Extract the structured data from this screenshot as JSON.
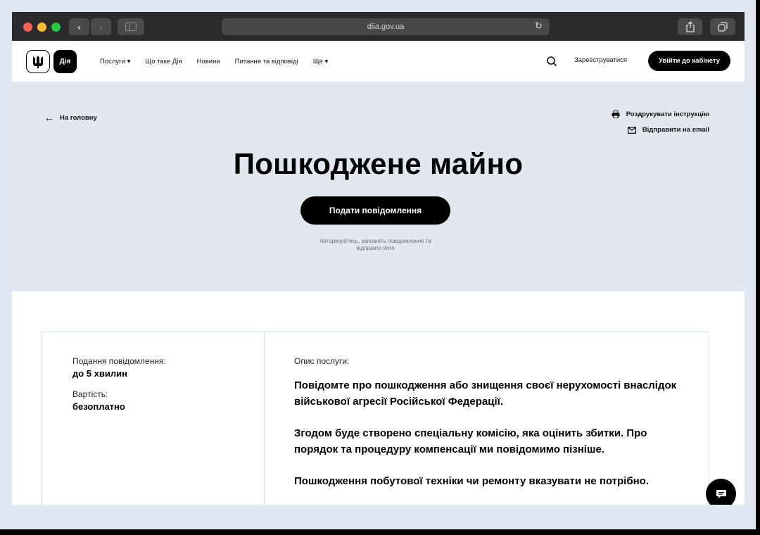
{
  "browser": {
    "url": "diia.gov.ua"
  },
  "header": {
    "logo_text": "Дія",
    "nav": [
      {
        "label": "Послуги ▾"
      },
      {
        "label": "Що таке Дія"
      },
      {
        "label": "Новини"
      },
      {
        "label": "Питання та відповіді"
      },
      {
        "label": "Ще ▾"
      }
    ],
    "register_label": "Зареєструватися",
    "login_label": "Увійти до кабінету"
  },
  "hero": {
    "back_label": "На головну",
    "print_label": "Роздрукувати інструкцію",
    "email_label": "Відправити на email",
    "title": "Пошкоджене майно",
    "submit_label": "Подати повідомлення",
    "hint_line1": "Авторизуйтесь, заповніть повідомлення та",
    "hint_line2": "відправте його"
  },
  "card": {
    "submission_label": "Подання повідомлення:",
    "submission_value": "до 5 хвилин",
    "cost_label": "Вартість:",
    "cost_value": "безоплатно",
    "description_label": "Опис послуги:",
    "paragraphs": [
      "Повідомте про пошкодження або знищення своєї нерухомості внаслідок військової агресії Російської Федерації.",
      "Згодом буде створено спеціальну комісію, яка оцінить збитки. Про порядок та процедуру компенсації ми повідомимо пізніше.",
      "Пошкодження побутової техніки чи ремонту вказувати не потрібно."
    ]
  },
  "colors": {
    "hero_bg": "#e3e8f0",
    "accent": "#000000",
    "frame_bg": "#dfe9f3"
  }
}
